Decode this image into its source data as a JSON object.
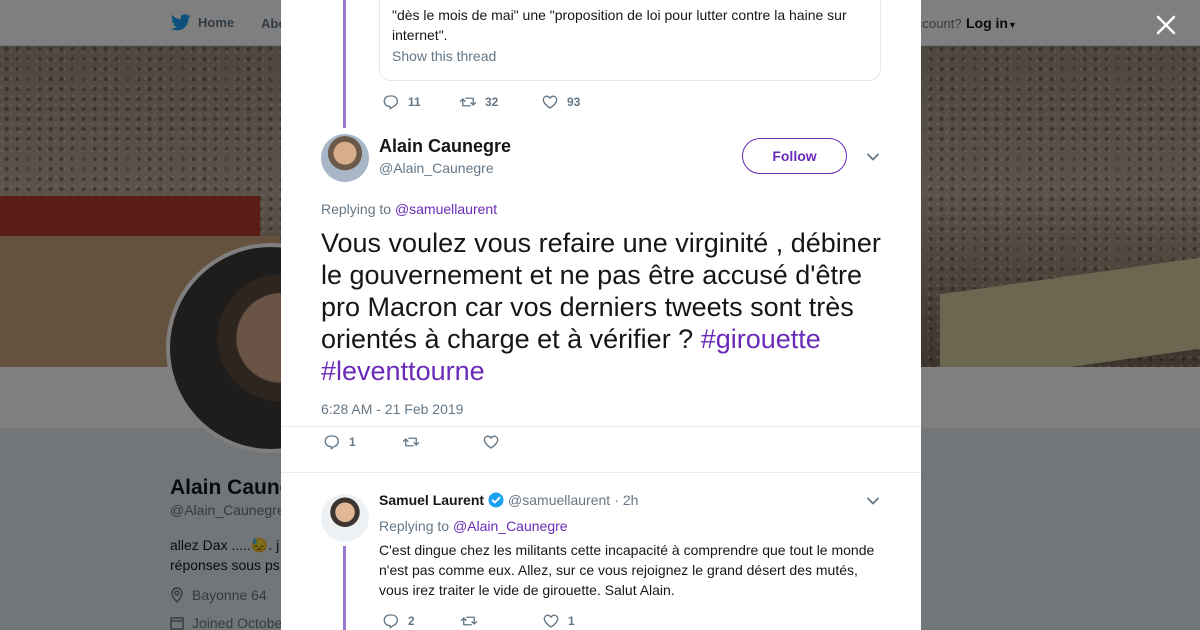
{
  "background": {
    "nav": {
      "home_label": "Home",
      "about_label": "Abo",
      "account_label": "ccount?",
      "login_label": "Log in"
    },
    "profile": {
      "name": "Alain Caune",
      "handle": "@Alain_Caunegre",
      "bio_line1": "allez Dax .....😓. j",
      "bio_line2": "réponses sous ps",
      "location": "Bayonne 64",
      "joined": "Joined Octobe"
    }
  },
  "close_label": "×",
  "previous_tweet": {
    "text": "\"dès le mois de mai\" une \"proposition de loi pour lutter contre la haine sur internet\".",
    "show_thread": "Show this thread",
    "replies": "11",
    "retweets": "32",
    "likes": "93"
  },
  "main_tweet": {
    "author_name": "Alain Caunegre",
    "author_handle": "@Alain_Caunegre",
    "follow_label": "Follow",
    "replying_prefix": "Replying to",
    "replying_to": "@samuellaurent",
    "text": "Vous voulez vous refaire une virginité , débiner le gouvernement et ne pas être accusé d'être pro Macron car vos derniers tweets sont très orientés à charge et à vérifier ?",
    "hashtag1": "#girouette",
    "hashtag2": "#leventtourne",
    "timestamp": "6:28 AM - 21 Feb 2019",
    "replies": "1"
  },
  "reply_tweet": {
    "author_name": "Samuel Laurent",
    "author_handle": "@samuellaurent",
    "time": "2h",
    "replying_prefix": "Replying to",
    "replying_to": "@Alain_Caunegre",
    "text": "C'est dingue chez les militants cette incapacité à comprendre que tout le monde n'est pas comme eux. Allez, sur ce vous rejoignez le grand désert des mutés, vous irez traiter le vide de girouette. Salut Alain.",
    "replies": "2",
    "likes": "1"
  },
  "colors": {
    "accent": "#6a2bb8",
    "muted": "#657786",
    "thread": "#9977cc"
  }
}
